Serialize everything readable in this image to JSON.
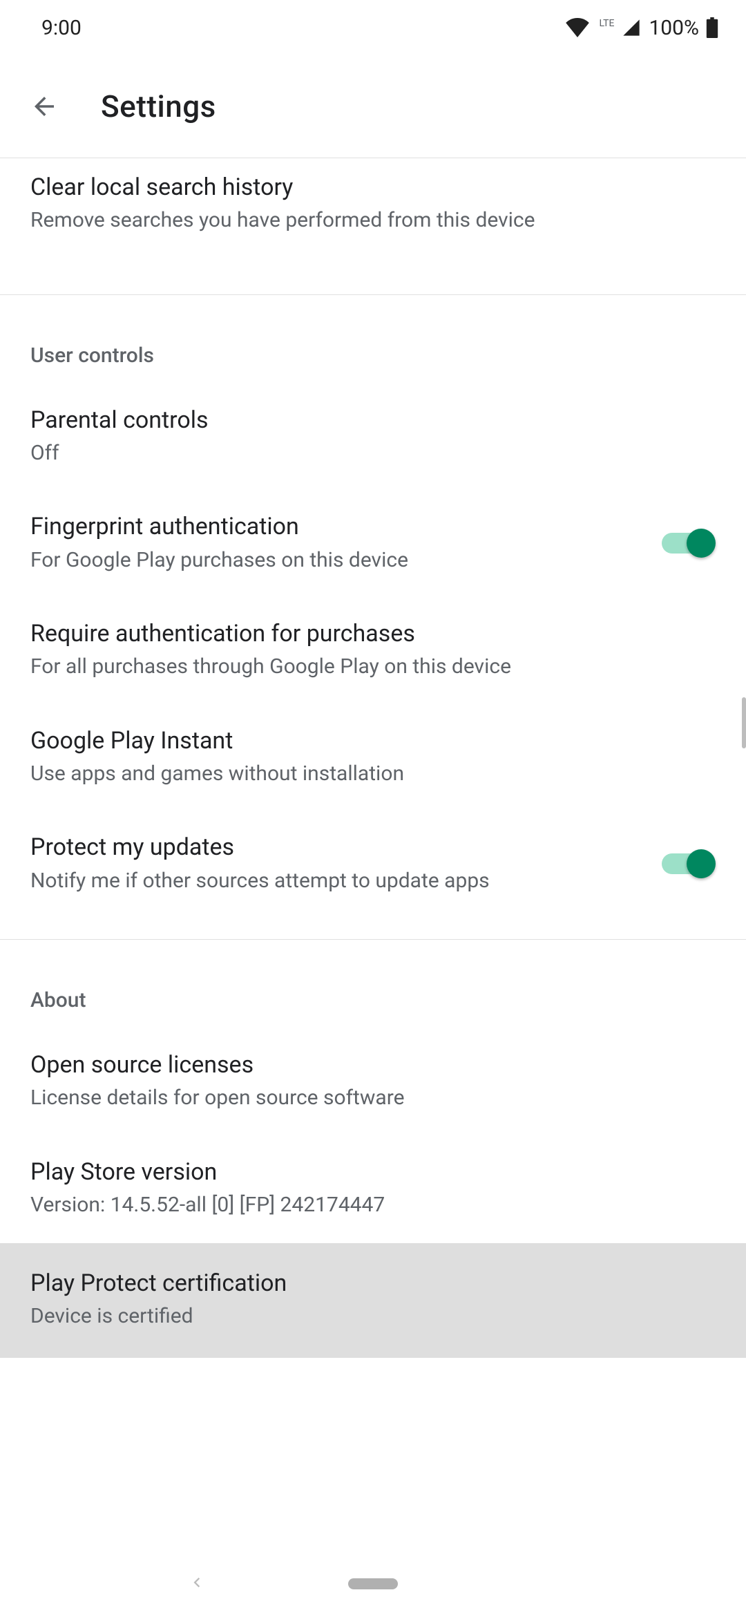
{
  "status_bar": {
    "time": "9:00",
    "battery_text": "100%",
    "network_label": "LTE"
  },
  "app_bar": {
    "title": "Settings"
  },
  "rows": {
    "clear_history": {
      "title": "Clear local search history",
      "sub": "Remove searches you have performed from this device"
    }
  },
  "user_controls": {
    "header": "User controls",
    "parental": {
      "title": "Parental controls",
      "sub": "Off"
    },
    "fingerprint": {
      "title": "Fingerprint authentication",
      "sub": "For Google Play purchases on this device"
    },
    "require_auth": {
      "title": "Require authentication for purchases",
      "sub": "For all purchases through Google Play on this device"
    },
    "instant": {
      "title": "Google Play Instant",
      "sub": "Use apps and games without installation"
    },
    "protect_updates": {
      "title": "Protect my updates",
      "sub": "Notify me if other sources attempt to update apps"
    }
  },
  "about": {
    "header": "About",
    "licenses": {
      "title": "Open source licenses",
      "sub": "License details for open source software"
    },
    "version": {
      "title": "Play Store version",
      "sub": "Version: 14.5.52-all [0] [FP] 242174447"
    },
    "certification": {
      "title": "Play Protect certification",
      "sub": "Device is certified"
    }
  }
}
